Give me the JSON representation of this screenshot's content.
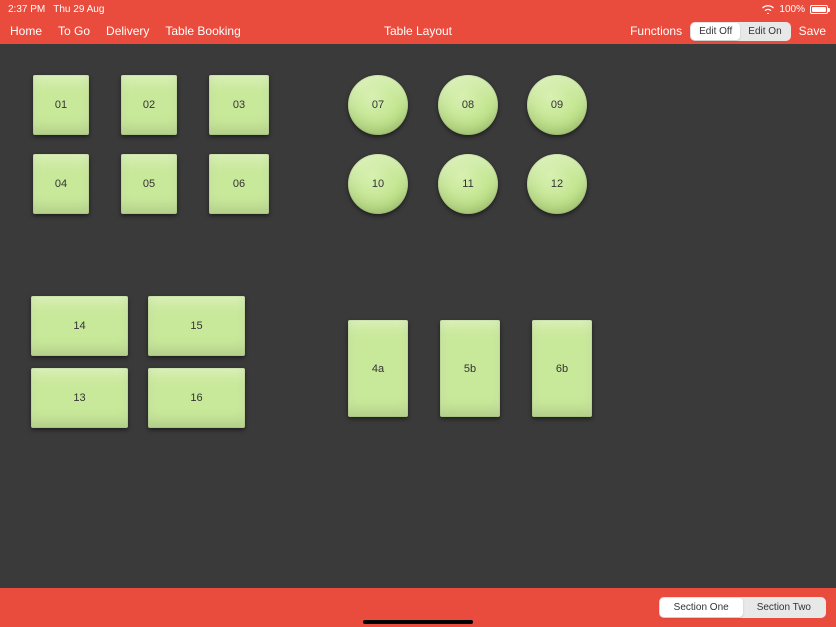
{
  "status": {
    "time": "2:37 PM",
    "date": "Thu 29 Aug",
    "battery": "100%"
  },
  "nav": {
    "items": [
      {
        "label": "Home"
      },
      {
        "label": "To Go"
      },
      {
        "label": "Delivery"
      },
      {
        "label": "Table Booking"
      }
    ],
    "title": "Table Layout",
    "functions": "Functions",
    "edit_off": "Edit Off",
    "edit_on": "Edit On",
    "save": "Save"
  },
  "tables": {
    "sq_small": [
      {
        "label": "01"
      },
      {
        "label": "02"
      },
      {
        "label": "03"
      },
      {
        "label": "04"
      },
      {
        "label": "05"
      },
      {
        "label": "06"
      }
    ],
    "round": [
      {
        "label": "07"
      },
      {
        "label": "08"
      },
      {
        "label": "09"
      },
      {
        "label": "10"
      },
      {
        "label": "11"
      },
      {
        "label": "12"
      }
    ],
    "wide": [
      {
        "label": "14"
      },
      {
        "label": "15"
      },
      {
        "label": "13"
      },
      {
        "label": "16"
      }
    ],
    "tall": [
      {
        "label": "4a"
      },
      {
        "label": "5b"
      },
      {
        "label": "6b"
      }
    ]
  },
  "sections": {
    "one": "Section One",
    "two": "Section Two"
  }
}
